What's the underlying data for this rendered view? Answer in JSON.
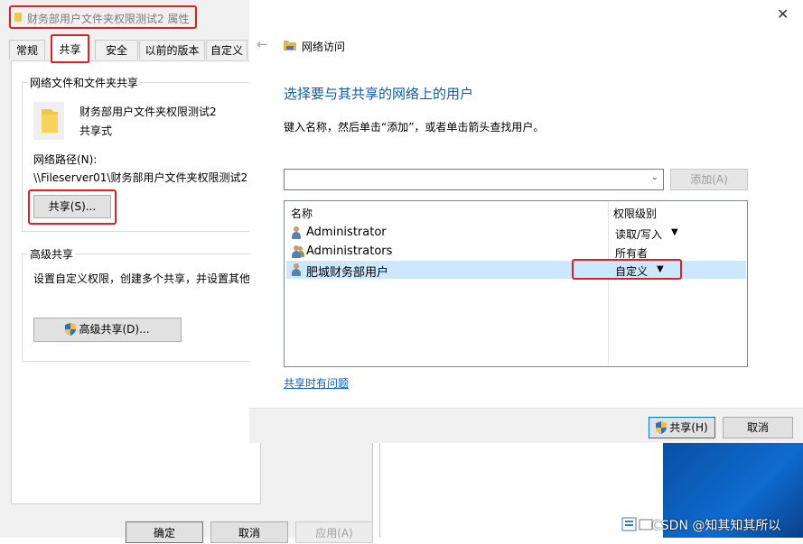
{
  "properties": {
    "title": "财务部用户文件夹权限测试2 属性",
    "tabs": [
      "常规",
      "共享",
      "安全",
      "以前的版本",
      "自定义"
    ],
    "group1_label": "网络文件和文件夹共享",
    "folder_name": "财务部用户文件夹权限测试2",
    "share_state": "共享式",
    "network_path_label": "网络路径(N):",
    "network_path": "\\\\Fileserver01\\财务部用户文件夹权限测试2",
    "share_button": "共享(S)...",
    "group2_label": "高级共享",
    "advanced_desc": "设置自定义权限，创建多个共享，并设置其他",
    "advanced_button": "高级共享(D)...",
    "buttons": {
      "ok": "确定",
      "cancel": "取消",
      "apply": "应用(A)"
    }
  },
  "network": {
    "breadcrumb": "网络访问",
    "heading": "选择要与其共享的网络上的用户",
    "instruction": "键入名称，然后单击“添加”，或者单击箭头查找用户。",
    "add_button": "添加(A)",
    "col_name": "名称",
    "col_permission": "权限级别",
    "rows": [
      {
        "name": "Administrator",
        "permission": "读取/写入"
      },
      {
        "name": "Administrators",
        "permission": "所有者"
      },
      {
        "name": "肥城财务部用户",
        "permission": "自定义"
      }
    ],
    "help_link": "共享时有问题",
    "share_button": "共享(H)",
    "cancel_button": "取消"
  },
  "watermark": "CSDN @知其知其所以",
  "colors": {
    "accent": "#e02020",
    "heading_blue": "#0b5ca6",
    "selection": "#cce8ff",
    "link": "#0066cc"
  }
}
